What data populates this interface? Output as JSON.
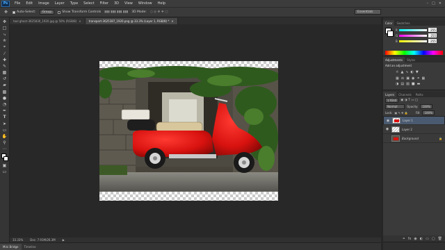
{
  "app": {
    "logo": "Ps"
  },
  "menu": [
    "File",
    "Edit",
    "Image",
    "Layer",
    "Type",
    "Select",
    "Filter",
    "3D",
    "View",
    "Window",
    "Help"
  ],
  "options_bar": {
    "auto_select": "Auto-Select:",
    "group_value": "Group",
    "show_transform": "Show Transform Controls",
    "mode_3d": "3D Mode:",
    "workspace": "Essentials"
  },
  "tabs": [
    {
      "label": "tool ghost-3625830_1920.jpg @ 50% (RGB/8)",
      "active": false
    },
    {
      "label": "transport-3625387_1920.png @ 33.3% (Layer 1, RGB/8) *",
      "active": true
    }
  ],
  "status": {
    "zoom": "33.33%",
    "doc": "Doc: 7.91M/26.3M"
  },
  "bottom_tabs": [
    "Mini Bridge",
    "Timeline"
  ],
  "color_panel": {
    "tabs": [
      "Color",
      "Swatches"
    ],
    "channels": [
      {
        "label": "R",
        "value": "255"
      },
      {
        "label": "G",
        "value": "255"
      },
      {
        "label": "B",
        "value": "255"
      }
    ]
  },
  "adjustments_panel": {
    "tabs": [
      "Adjustments",
      "Styles"
    ],
    "heading": "Add an adjustment"
  },
  "layers_panel": {
    "tabs": [
      "Layers",
      "Channels",
      "Paths"
    ],
    "kind_label": "Kind",
    "blend_mode": "Normal",
    "opacity_label": "Opacity:",
    "opacity_value": "100%",
    "lock_label": "Lock:",
    "fill_label": "Fill:",
    "fill_value": "100%",
    "layers": [
      {
        "name": "Layer 1",
        "selected": true
      },
      {
        "name": "Layer 2",
        "selected": false
      },
      {
        "name": "Background",
        "selected": false
      }
    ]
  }
}
